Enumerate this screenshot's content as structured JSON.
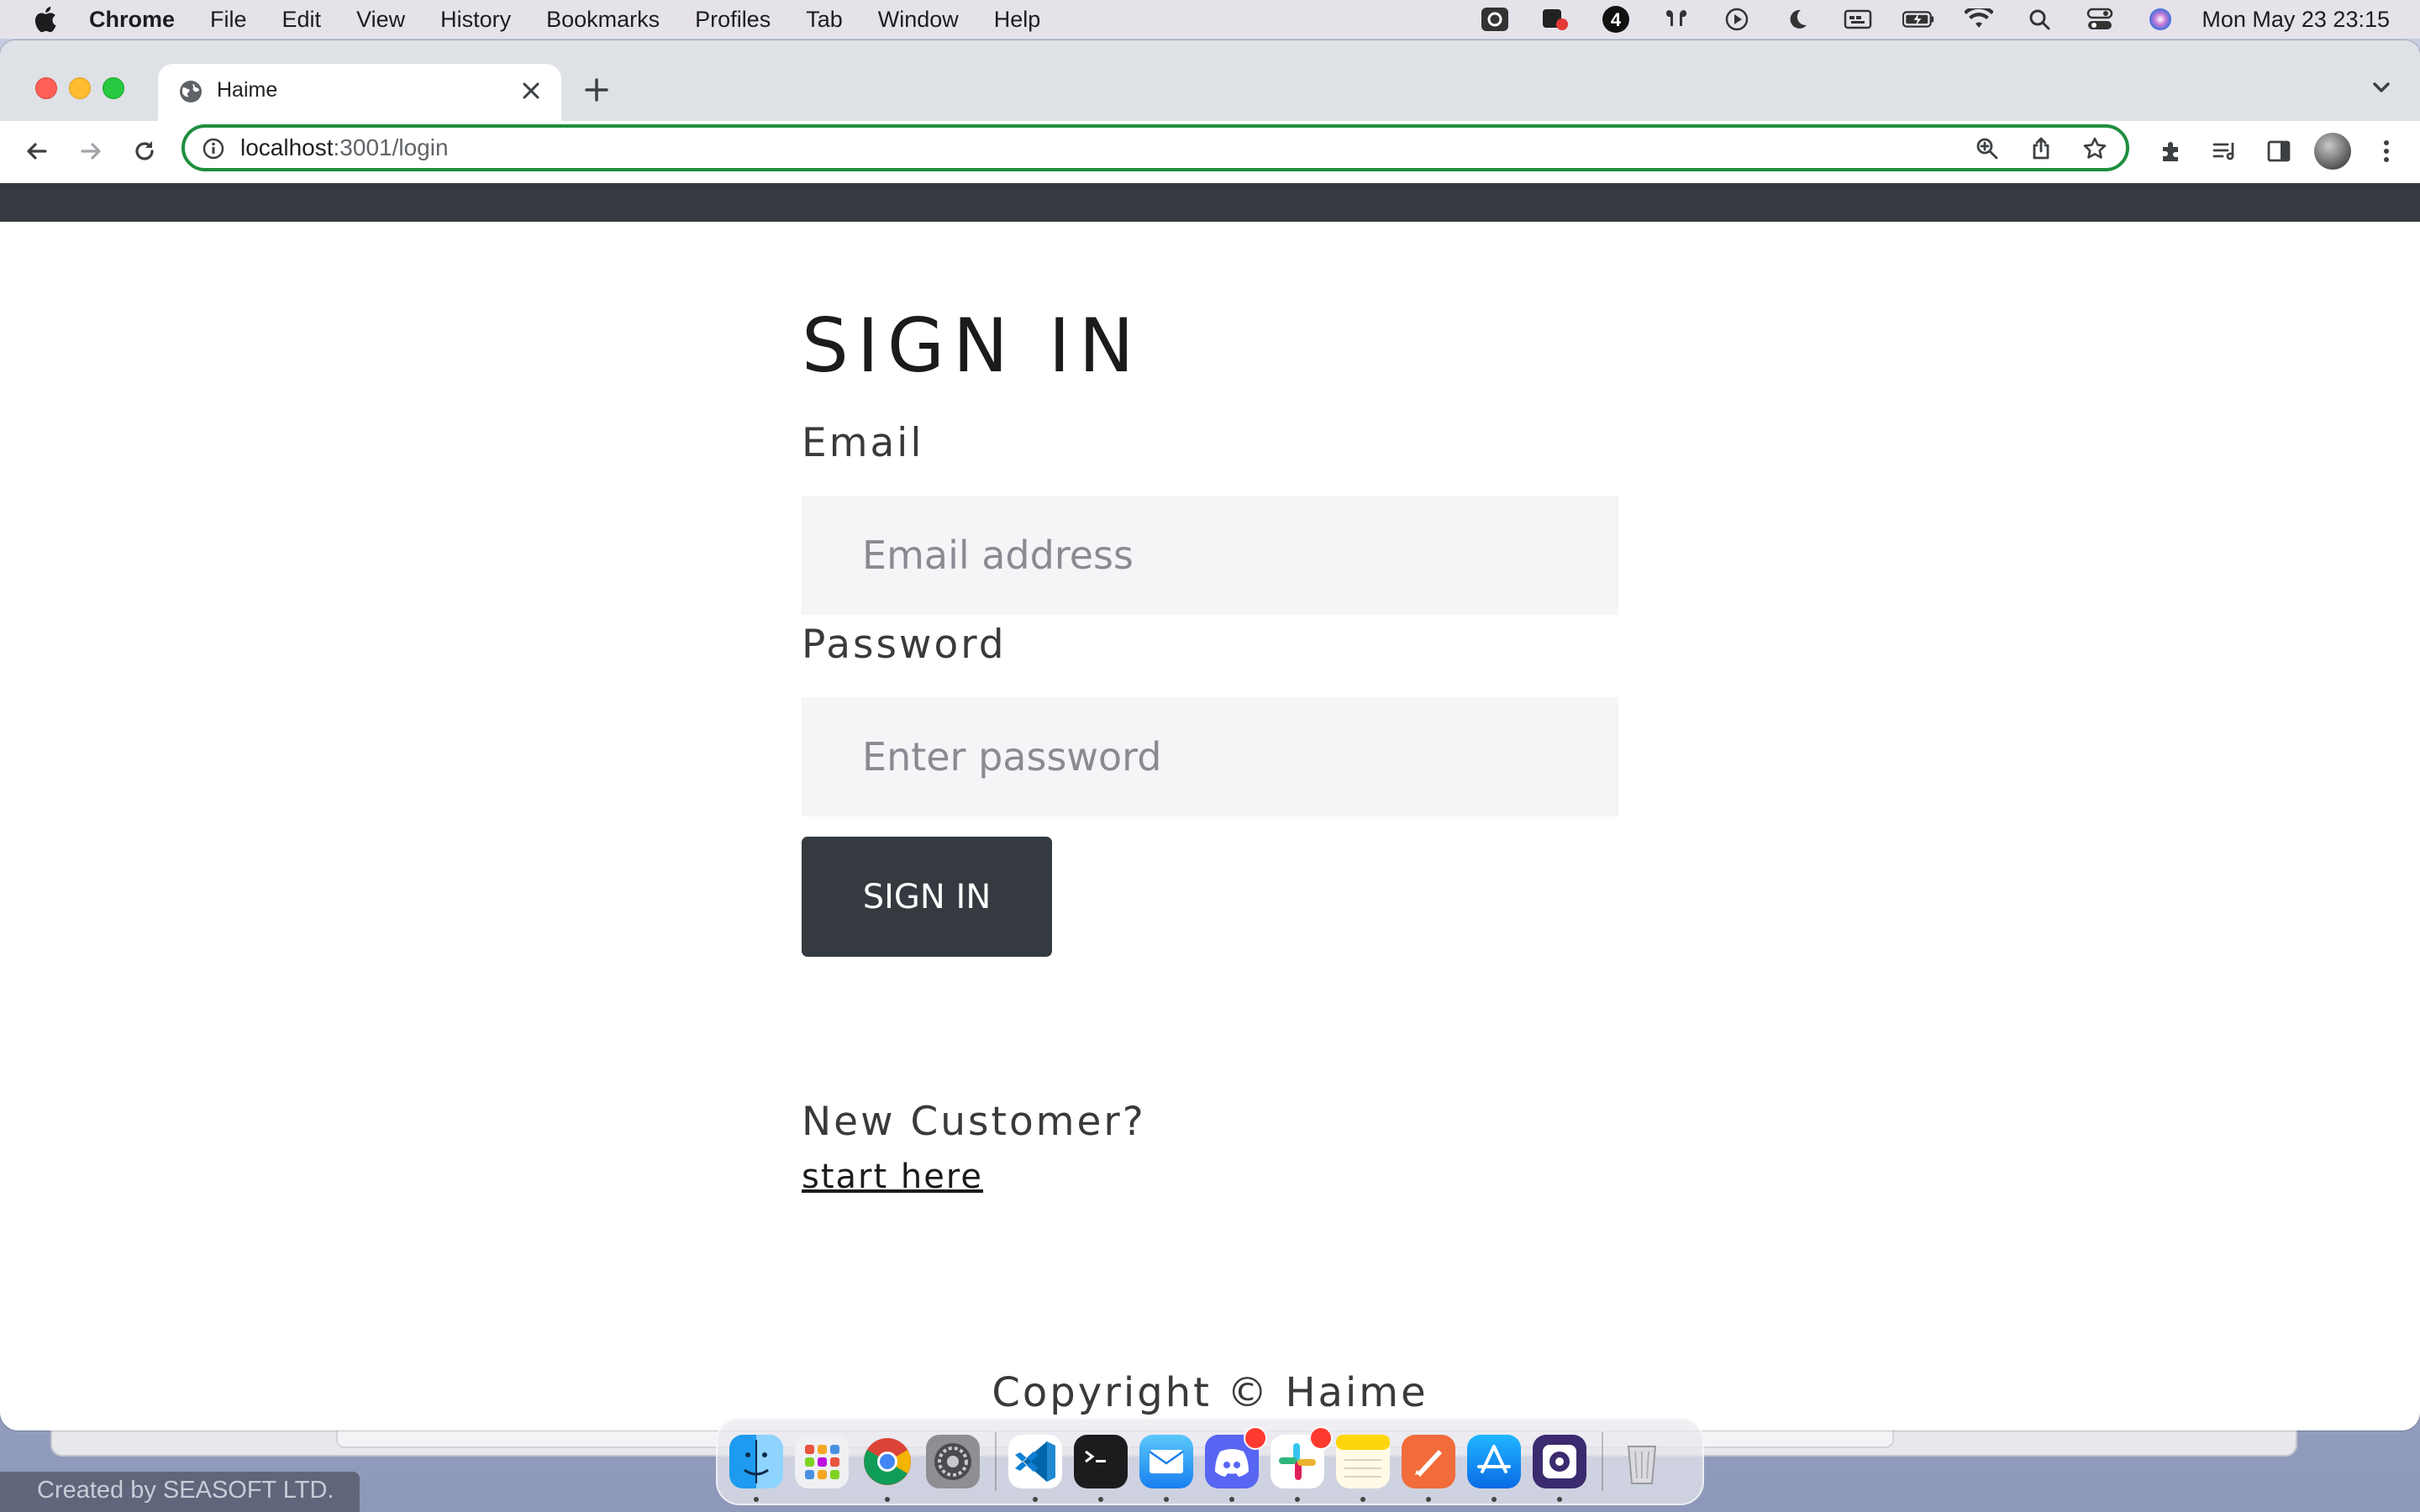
{
  "menubar": {
    "app_name": "Chrome",
    "items": [
      "File",
      "Edit",
      "View",
      "History",
      "Bookmarks",
      "Profiles",
      "Tab",
      "Window",
      "Help"
    ],
    "clock": "Mon May 23  23:15"
  },
  "browser": {
    "tab_title": "Haime",
    "url_host": "localhost",
    "url_path": ":3001/login"
  },
  "page": {
    "title": "SIGN IN",
    "email_label": "Email",
    "email_placeholder": "Email address",
    "password_label": "Password",
    "password_placeholder": "Enter password",
    "submit_label": "SIGN IN",
    "new_customer_text": "New Customer?",
    "register_link": "start here",
    "footer": "Copyright © Haime"
  },
  "desktop": {
    "watermark": "Created by SEASOFT LTD."
  },
  "colors": {
    "header": "#343a40",
    "button": "#343a40",
    "input_bg": "#f5f5f8",
    "omnibox_border": "#1e8e3e"
  }
}
